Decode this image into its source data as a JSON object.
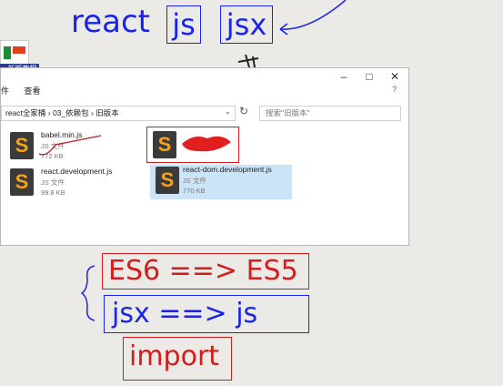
{
  "annotations": {
    "react": "react",
    "js": "js",
    "jsx": "jsx",
    "es6": "ES6 ==> ES5",
    "jsx_to_js": "jsx ==> js",
    "import": "import"
  },
  "desktop_icon": {
    "label": "...新版教程"
  },
  "explorer": {
    "ribbon": [
      "件",
      "查看"
    ],
    "breadcrumb": "react全家桶 › 03_依赖包 › 旧版本",
    "search_placeholder": "搜索\"旧版本\"",
    "files": [
      {
        "name": "babel.min.js",
        "type": "JS 文件",
        "size": "772 KB"
      },
      {
        "name": "",
        "type": "",
        "size": ""
      },
      {
        "name": "react.development.js",
        "type": "JS 文件",
        "size": "99.8 KB"
      },
      {
        "name": "react-dom.development.js",
        "type": "JS 文件",
        "size": "770 KB"
      }
    ]
  },
  "colors": {
    "pen_blue": "#1a24e8",
    "pen_red": "#d21d1d",
    "sublime_orange": "#f7a21b"
  }
}
